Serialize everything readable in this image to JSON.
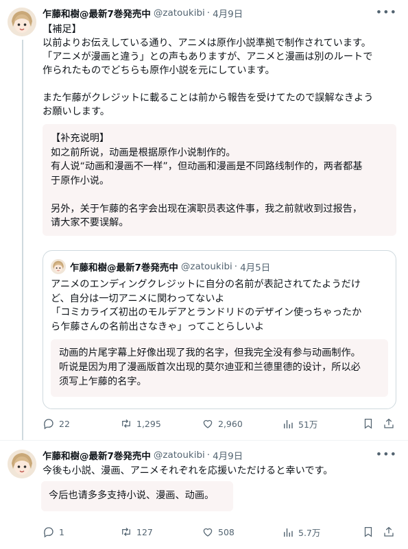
{
  "tweet1": {
    "author": {
      "name": "乍藤和樹@最新7巻発売中",
      "handle": "@zatoukibi",
      "separator": "·",
      "date": "4月9日"
    },
    "more_label": "•••",
    "text": "【補足】\n以前よりお伝えしている通り、アニメは原作小説準拠で制作されています。\n「アニメが漫画と違う」との声もありますが、アニメと漫画は別のルートで\n作られたものでどちらも原作小説を元にしています。\n\nまた乍藤がクレジットに載ることは前から報告を受けてたので誤解なきよう\nお願いします。",
    "translation": "【补充说明】\n如之前所说，动画是根据原作小说制作的。\n有人说“动画和漫画不一样”，但动画和漫画是不同路线制作的，两者都基\n于原作小说。\n\n另外，关于乍藤的名字会出现在演职员表这件事，我之前就收到过报告，\n请大家不要误解。",
    "quote": {
      "name": "乍藤和樹@最新7巻発売中",
      "handle": "@zatoukibi",
      "separator": "·",
      "date": "4月5日",
      "text": "アニメのエンディングクレジットに自分の名前が表記されてたようだけ\nど、自分は一切アニメに関わってないよ\n「コミカライズ初出のモルデアとランドリドのデザイン使っちゃったか\nら乍藤さんの名前出さなきゃ」ってことらしいよ",
      "translation": "动画的片尾字幕上好像出现了我的名字，但我完全没有参与动画制作。\n听说是因为用了漫画版首次出现的莫尔迪亚和兰德里德的设计，所以必\n须写上乍藤的名字。"
    },
    "stats": {
      "replies": "22",
      "retweets": "1,295",
      "likes": "2,960",
      "views": "51万"
    }
  },
  "tweet2": {
    "author": {
      "name": "乍藤和樹@最新7巻発売中",
      "handle": "@zatoukibi",
      "separator": "·",
      "date": "4月9日"
    },
    "more_label": "•••",
    "text": "今後も小説、漫画、アニメそれぞれを応援いただけると幸いです。",
    "translation": "今后也请多多支持小说、漫画、动画。",
    "stats": {
      "replies": "1",
      "retweets": "127",
      "likes": "508",
      "views": "5.7万"
    }
  },
  "icons": {
    "reply": "reply-icon",
    "retweet": "retweet-icon",
    "like": "heart-icon",
    "views": "views-icon",
    "bookmark": "bookmark-icon",
    "share": "share-icon"
  },
  "colors": {
    "text": "#0f1419",
    "secondary": "#536471",
    "border": "#cfd9de",
    "translation_bg": "#faf4f4"
  }
}
